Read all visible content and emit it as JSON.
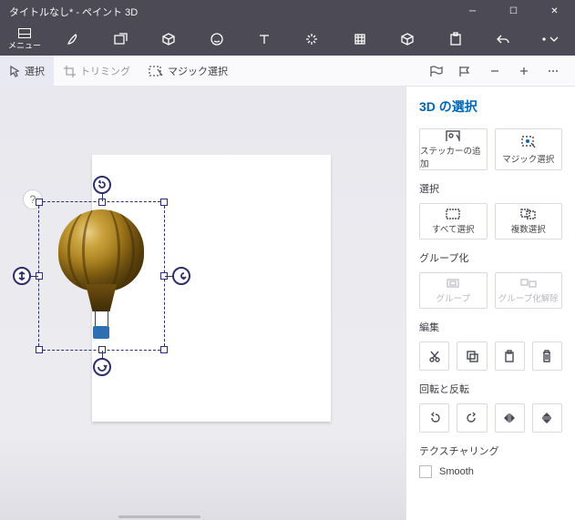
{
  "title": "タイトルなし* - ペイント 3D",
  "menu_label": "メニュー",
  "subbar": {
    "select": "選択",
    "trimming": "トリミング",
    "magic": "マジック選択"
  },
  "help": "?",
  "panel": {
    "heading": "3D の選択",
    "make_sticker": "ステッカーの追加",
    "magic_select": "マジック選択",
    "select_h": "選択",
    "select_all": "すべて選択",
    "multi_select": "複数選択",
    "group_h": "グループ化",
    "group": "グループ",
    "ungroup": "グループ化解除",
    "edit_h": "編集",
    "rotflip_h": "回転と反転",
    "tex_h": "テクスチャリング",
    "smooth": "Smooth"
  }
}
